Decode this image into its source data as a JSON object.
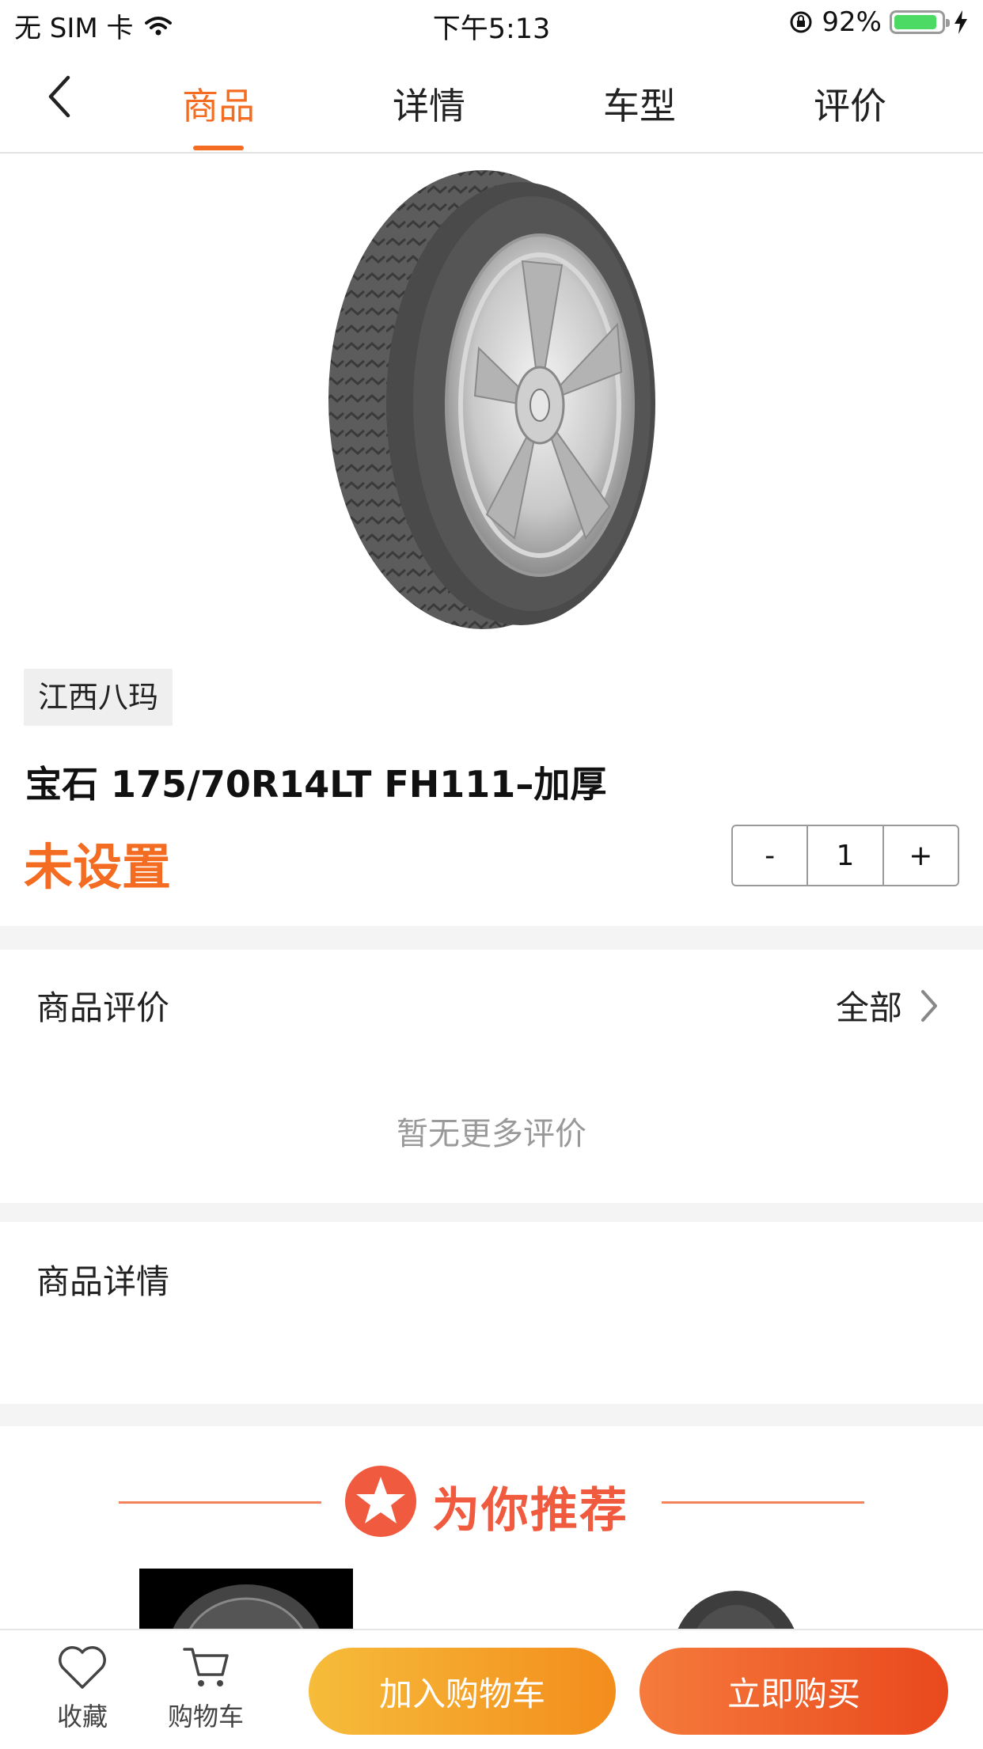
{
  "status_bar": {
    "carrier": "无 SIM 卡",
    "time": "下午5:13",
    "battery_percent": "92%",
    "battery_level": 0.92,
    "battery_color": "#4cd964"
  },
  "nav": {
    "back_icon": "chevron-left-icon",
    "tabs": [
      {
        "label": "商品",
        "active": true
      },
      {
        "label": "详情",
        "active": false
      },
      {
        "label": "车型",
        "active": false
      },
      {
        "label": "评价",
        "active": false
      }
    ],
    "accent_color": "#f36c21"
  },
  "product": {
    "image": "tire-with-alloy-wheel",
    "brand": "江西八玛",
    "title": "宝石 175/70R14LT FH111–加厚",
    "price": "未设置"
  },
  "quantity": {
    "minus": "-",
    "value": "1",
    "plus": "+"
  },
  "reviews": {
    "title": "商品评价",
    "see_all": "全部",
    "empty": "暂无更多评价"
  },
  "details": {
    "title": "商品详情"
  },
  "recommend": {
    "title": "为你推荐"
  },
  "bottom_bar": {
    "favorite": "收藏",
    "cart": "购物车",
    "add_to_cart": "加入购物车",
    "buy_now": "立即购买"
  }
}
